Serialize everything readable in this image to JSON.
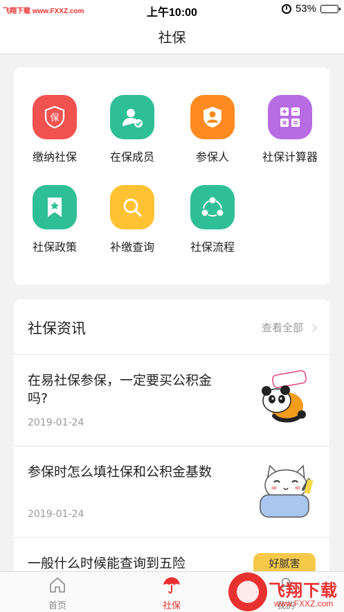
{
  "status_bar": {
    "watermark": "飞翔下载 www.FXXZ.com",
    "time": "上午10:00",
    "battery": "53%",
    "battery_level": 0.53
  },
  "nav": {
    "title": "社保"
  },
  "grid": {
    "items": [
      {
        "label": "缴纳社保",
        "icon": "shield-bao-icon",
        "color": "#f0524f"
      },
      {
        "label": "在保成员",
        "icon": "user-check-icon",
        "color": "#2fbf96"
      },
      {
        "label": "参保人",
        "icon": "user-shield-icon",
        "color": "#ff8a1f"
      },
      {
        "label": "社保计算器",
        "icon": "calculator-icon",
        "color": "#b86ce4"
      },
      {
        "label": "社保政策",
        "icon": "bookmark-star-icon",
        "color": "#2fbf96"
      },
      {
        "label": "补缴查询",
        "icon": "search-icon",
        "color": "#ffc233"
      },
      {
        "label": "社保流程",
        "icon": "share-nodes-icon",
        "color": "#2fbf96"
      }
    ]
  },
  "news": {
    "title": "社保资讯",
    "more": "查看全部",
    "items": [
      {
        "title": "在易社保参保，一定要买公积金吗?",
        "date": "2019-01-24",
        "thumb": "panda-sticker"
      },
      {
        "title": "参保时怎么填社保和公积金基数",
        "date": "2019-01-24",
        "thumb": "cat-pillow-sticker"
      },
      {
        "title": "一般什么时候能查询到五险",
        "date": "",
        "thumb": "sticker-好腻害"
      }
    ],
    "sticker_text": "好腻害"
  },
  "tabs": [
    {
      "label": "首页",
      "icon": "home-icon"
    },
    {
      "label": "社保",
      "icon": "umbrella-icon",
      "active": true
    },
    {
      "label": "我的",
      "icon": "user-icon"
    }
  ],
  "watermark_bottom": {
    "text": "飞翔下载",
    "url": "www.FXXZ.com"
  }
}
